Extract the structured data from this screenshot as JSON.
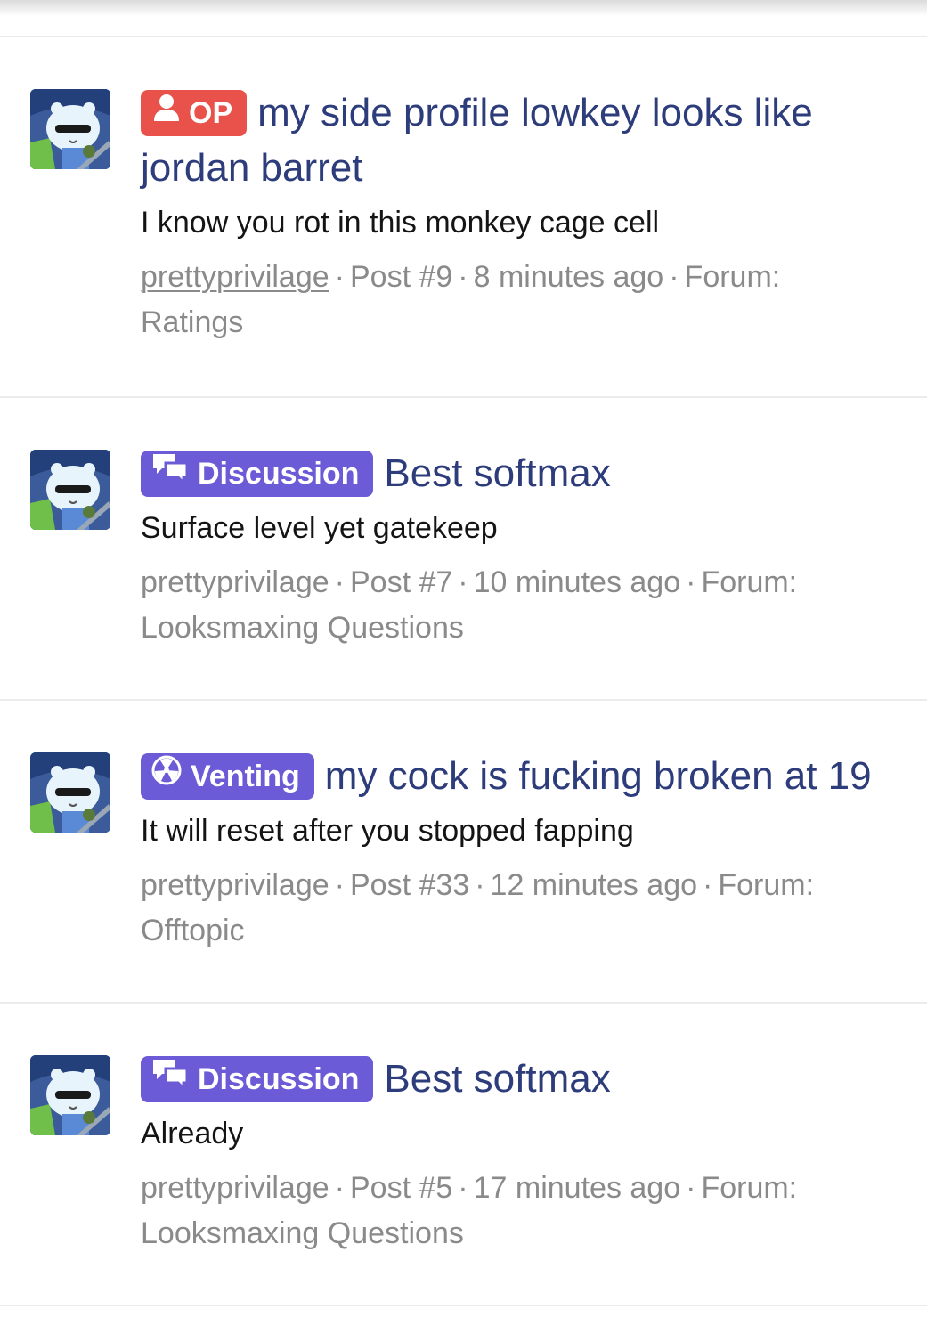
{
  "results": [
    {
      "badge": "OP",
      "badge_type": "op",
      "badge_icon": "user-icon",
      "title": "my side profile lowkey looks like jordan barret",
      "snippet": "I know you rot in this monkey cage cell",
      "user": "prettyprivilage",
      "post": "Post #9",
      "time": "8 minutes ago",
      "forum_label": "Forum:",
      "forum": "Ratings"
    },
    {
      "badge": "Discussion",
      "badge_type": "discussion",
      "badge_icon": "chat-bubbles-icon",
      "title": "Best softmax",
      "snippet": "Surface level yet gatekeep",
      "user": "prettyprivilage",
      "post": "Post #7",
      "time": "10 minutes ago",
      "forum_label": "Forum:",
      "forum": "Looksmaxing Questions"
    },
    {
      "badge": "Venting",
      "badge_type": "venting",
      "badge_icon": "radiation-icon",
      "title": "my cock is fucking broken at 19",
      "snippet": "It will reset after you stopped fapping",
      "user": "prettyprivilage",
      "post": "Post #33",
      "time": "12 minutes ago",
      "forum_label": "Forum:",
      "forum": "Offtopic"
    },
    {
      "badge": "Discussion",
      "badge_type": "discussion",
      "badge_icon": "chat-bubbles-icon",
      "title": "Best softmax",
      "snippet": "Already",
      "user": "prettyprivilage",
      "post": "Post #5",
      "time": "17 minutes ago",
      "forum_label": "Forum:",
      "forum": "Looksmaxing Questions"
    }
  ],
  "colors": {
    "title": "#2d3c7a",
    "op_badge": "#e8524a",
    "prefix_badge": "#6b5bd6",
    "meta": "#8a8a8a"
  }
}
